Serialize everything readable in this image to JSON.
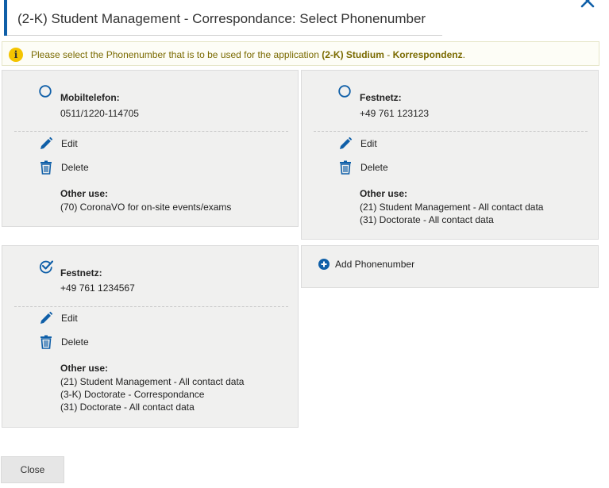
{
  "dialog": {
    "title": "(2-K) Student Management - Correspondance: Select Phonenumber"
  },
  "info": {
    "prefix": "Please select the Phonenumber that is to be used for the application ",
    "app_a": "(2-K) Studium",
    "separator": " - ",
    "app_b": "Korrespondenz",
    "suffix": "."
  },
  "cards": [
    {
      "type_label": "Mobiltelefon:",
      "number": "0511/1220-114705",
      "selected": false,
      "edit_label": "Edit",
      "delete_label": "Delete",
      "other_use_title": "Other use:",
      "other_uses": [
        "(70) CoronaVO for on-site events/exams"
      ]
    },
    {
      "type_label": "Festnetz:",
      "number": "+49 761 123123",
      "selected": false,
      "edit_label": "Edit",
      "delete_label": "Delete",
      "other_use_title": "Other use:",
      "other_uses": [
        "(21) Student Management - All contact data",
        "(31) Doctorate - All contact data"
      ]
    },
    {
      "type_label": "Festnetz:",
      "number": "+49 761 1234567",
      "selected": true,
      "edit_label": "Edit",
      "delete_label": "Delete",
      "other_use_title": "Other use:",
      "other_uses": [
        "(21) Student Management - All contact data",
        "(3-K) Doctorate - Correspondance",
        "(31) Doctorate - All contact data"
      ]
    }
  ],
  "add_phonenumber_label": "Add Phonenumber",
  "close_label": "Close",
  "colors": {
    "accent": "#0f5fa8",
    "card_bg": "#f0f0ef",
    "info_text": "#7a6a00",
    "info_icon": "#f4c400"
  }
}
